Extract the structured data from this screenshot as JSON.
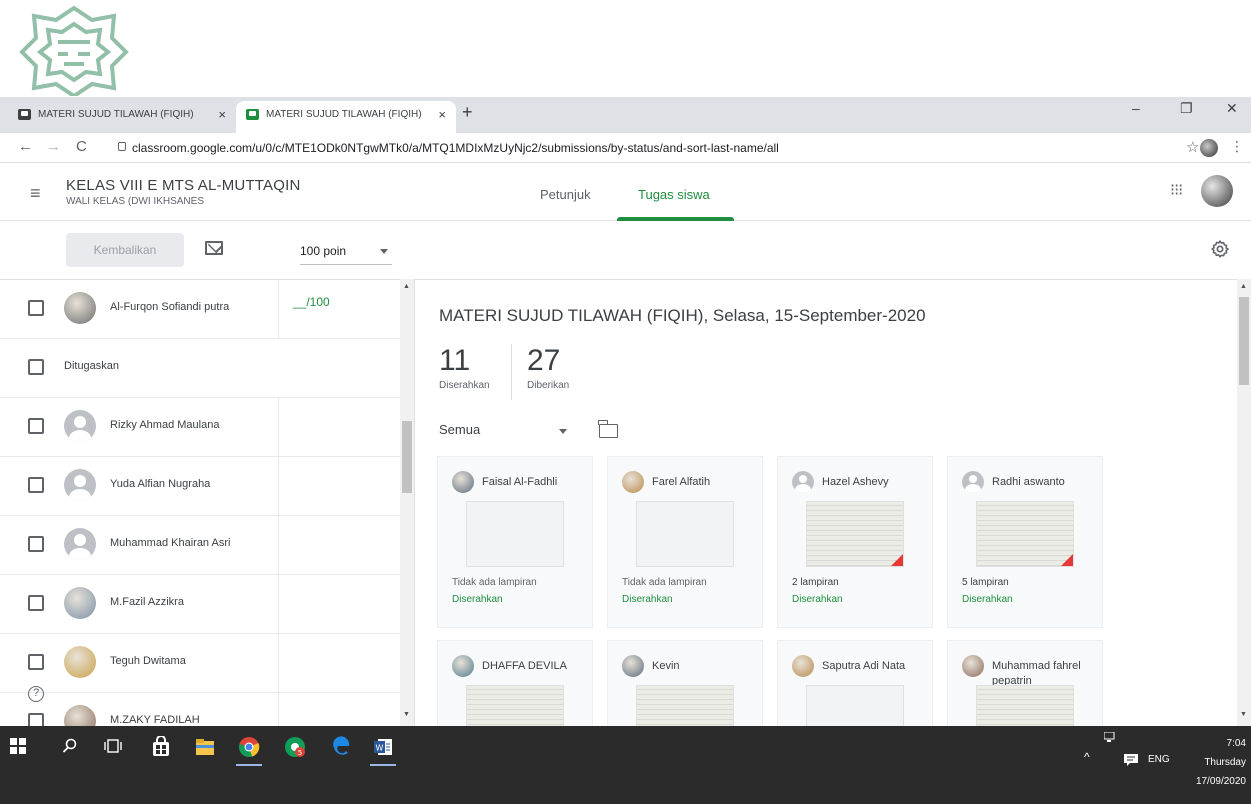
{
  "browser": {
    "tabs": [
      {
        "label": "MATERI SUJUD TILAWAH (FIQIH)",
        "close": "×"
      },
      {
        "label": "MATERI SUJUD TILAWAH (FIQIH)",
        "close": "×"
      }
    ],
    "new_tab": "+",
    "window_controls": {
      "minimize": "–",
      "restore": "❐",
      "close": "✕"
    },
    "url": "classroom.google.com/u/0/c/MTE1ODk0NTgwMTk0/a/MTQ1MDIxMzUyNjc2/submissions/by-status/and-sort-last-name/all",
    "nav": {
      "back": "←",
      "forward": "→",
      "reload": "C"
    },
    "bookmark_star": "☆",
    "menu_kebab": "⋮"
  },
  "header": {
    "course_title": "KELAS VIII E MTS AL-MUTTAQIN",
    "course_subtitle": "WALI KELAS (DWI IKHSANES",
    "menu_icon": "≡",
    "tabs": [
      {
        "label": "Petunjuk",
        "active": false
      },
      {
        "label": "Tugas siswa",
        "active": true
      }
    ],
    "apps_icon": "⁝⁝⁝"
  },
  "toolbar": {
    "return_label": "Kembalikan",
    "points_value": "100 poin"
  },
  "students": [
    {
      "name": "Al-Furqon Sofiandi putra",
      "grade": "__/100",
      "avatar": "photo",
      "type": "student"
    },
    {
      "name": "Ditugaskan",
      "grade": "",
      "avatar": "",
      "type": "group"
    },
    {
      "name": "Rizky Ahmad Maulana",
      "grade": "",
      "avatar": "gray",
      "type": "student"
    },
    {
      "name": "Yuda Alfian Nugraha",
      "grade": "",
      "avatar": "gray",
      "type": "student"
    },
    {
      "name": "Muhammad Khairan Asri",
      "grade": "",
      "avatar": "gray",
      "type": "student"
    },
    {
      "name": "M.Fazil Azzikra",
      "grade": "",
      "avatar": "photo",
      "type": "student"
    },
    {
      "name": "Teguh Dwitama",
      "grade": "",
      "avatar": "photo",
      "type": "student"
    },
    {
      "name": "M.ZAKY FADILAH",
      "grade": "",
      "avatar": "photo",
      "type": "student"
    }
  ],
  "help_icon": "?",
  "assignment": {
    "title": "MATERI SUJUD TILAWAH (FIQIH), Selasa, 15-September-2020",
    "submitted_count": "11",
    "submitted_label": "Diserahkan",
    "assigned_count": "27",
    "assigned_label": "Diberikan",
    "filter_label": "Semua"
  },
  "cards": [
    {
      "name": "Faisal Al-Fadhli",
      "attachments": "Tidak ada lampiran",
      "status": "Diserahkan",
      "thumb": "empty",
      "avatar": "photo"
    },
    {
      "name": "Farel Alfatih",
      "attachments": "Tidak ada lampiran",
      "status": "Diserahkan",
      "thumb": "empty",
      "avatar": "photo"
    },
    {
      "name": "Hazel Ashevy",
      "attachments": "2 lampiran",
      "status": "Diserahkan",
      "thumb": "paper",
      "avatar": "gray"
    },
    {
      "name": "Radhi aswanto",
      "attachments": "5 lampiran",
      "status": "Diserahkan",
      "thumb": "paper",
      "avatar": "gray"
    },
    {
      "name": "DHAFFA DEVILA",
      "attachments": "",
      "status": "",
      "thumb": "paper",
      "avatar": "photo"
    },
    {
      "name": "Kevin",
      "attachments": "",
      "status": "",
      "thumb": "paper",
      "avatar": "photo"
    },
    {
      "name": "Saputra Adi Nata",
      "attachments": "",
      "status": "",
      "thumb": "empty",
      "avatar": "photo"
    },
    {
      "name": "Muhammad fahrel pepatrin",
      "attachments": "",
      "status": "",
      "thumb": "paper",
      "avatar": "photo"
    }
  ],
  "taskbar": {
    "language": "ENG",
    "time": "7:04",
    "day": "Thursday",
    "date": "17/09/2020",
    "tray_chevron": "^"
  },
  "colors": {
    "accent_green": "#1e8e3e",
    "taskbar": "#2b2b2b",
    "tab_strip": "#dee1e6"
  }
}
